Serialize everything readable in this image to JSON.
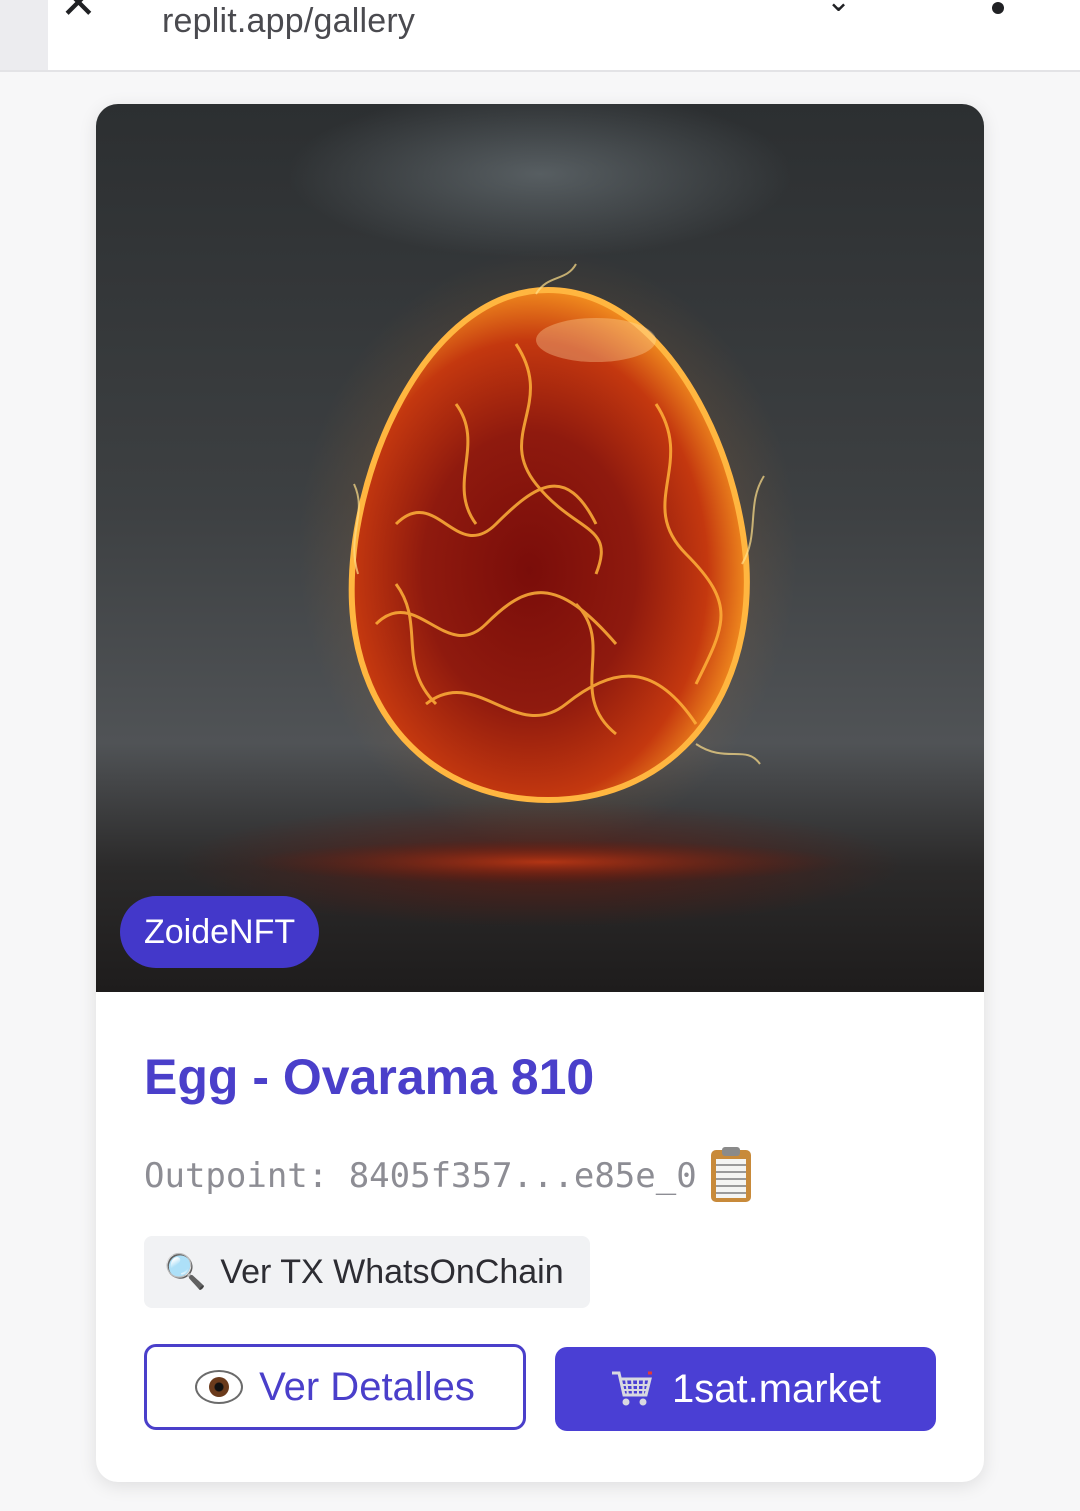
{
  "browser": {
    "url": "replit.app/gallery",
    "close_icon": "close-icon",
    "download_icon": "download-icon",
    "menu_icon": "more-vert-icon"
  },
  "card": {
    "badge": "ZoideNFT",
    "title": "Egg - Ovarama 810",
    "outpoint": "Outpoint: 8405f357...e85e_0",
    "copy_icon": "clipboard-icon",
    "tx_button": {
      "icon": "🔍",
      "label": "Ver TX WhatsOnChain"
    },
    "details_button": {
      "label": "Ver Detalles",
      "icon": "eye-icon"
    },
    "market_button": {
      "label": "1sat.market",
      "icon": "cart-icon"
    }
  },
  "colors": {
    "accent": "#4a3fca",
    "badge_bg": "#4338ca",
    "market_bg": "#4a3fd4"
  }
}
